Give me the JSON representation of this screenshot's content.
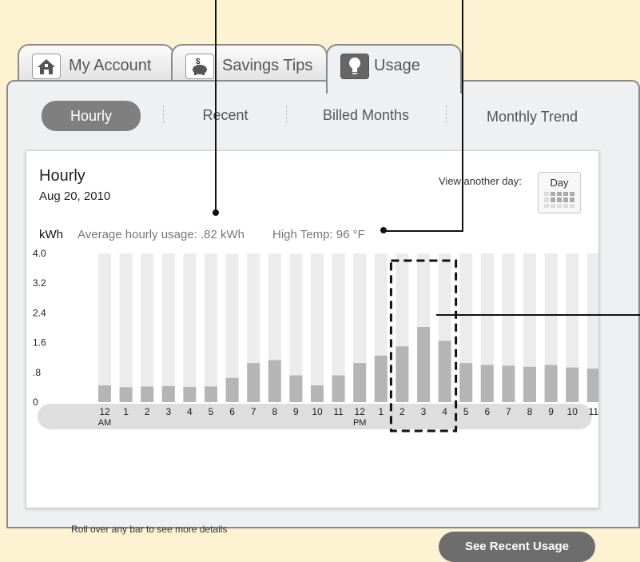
{
  "tabs": [
    {
      "label": "My Account",
      "icon": "home-icon"
    },
    {
      "label": "Savings Tips",
      "icon": "piggy-bank-icon"
    },
    {
      "label": "Usage",
      "icon": "lightbulb-icon"
    }
  ],
  "subnav": {
    "items": [
      "Hourly",
      "Recent",
      "Billed Months",
      "Monthly Trend"
    ],
    "active": "Hourly"
  },
  "card": {
    "title": "Hourly",
    "date": "Aug 20, 2010",
    "view_another_day": "View another day:",
    "day_button": "Day",
    "unit_label": "kWh",
    "avg_usage": "Average hourly usage: .82 kWh",
    "high_temp": "High Temp: 96 °F",
    "footer_note": "Roll over any bar to see more details",
    "recent_button": "See Recent Usage"
  },
  "colors": {
    "bar_fill": "#b5b5b5",
    "bar_track": "#ececec",
    "axis_band": "#dedede",
    "active_tab_icon": "#666666",
    "button": "#6d6d6d"
  },
  "chart_data": {
    "type": "bar",
    "ylabel": "kWh",
    "ylim": [
      0,
      4.0
    ],
    "yticks": [
      "4.0",
      "3.2",
      "2.4",
      "1.6",
      ".8",
      "0"
    ],
    "categories": [
      "12",
      "1",
      "2",
      "3",
      "4",
      "5",
      "6",
      "7",
      "8",
      "9",
      "10",
      "11",
      "12",
      "1",
      "2",
      "3",
      "4",
      "5",
      "6",
      "7",
      "8",
      "9",
      "10",
      "11"
    ],
    "sublabels": {
      "0": "AM",
      "12": "PM"
    },
    "values": [
      0.45,
      0.4,
      0.42,
      0.43,
      0.41,
      0.42,
      0.65,
      1.05,
      1.13,
      0.72,
      0.45,
      0.72,
      1.05,
      1.25,
      1.5,
      2.02,
      1.65,
      1.05,
      1.0,
      0.98,
      0.95,
      1.0,
      0.93,
      0.9
    ],
    "highlight_range": [
      14,
      16
    ],
    "grid": false,
    "legend": "none"
  }
}
